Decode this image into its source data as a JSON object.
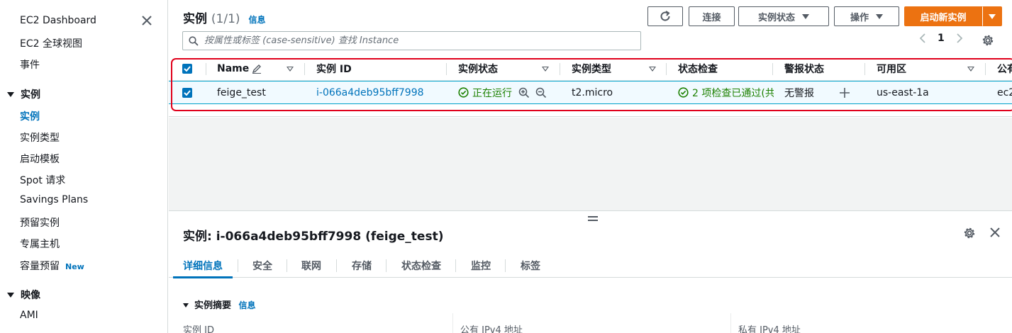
{
  "sidebar": {
    "dashboard": "EC2 Dashboard",
    "global_view": "EC2 全球视图",
    "events": "事件",
    "instances_section": "实例",
    "items": [
      "实例",
      "实例类型",
      "启动模板",
      "Spot 请求",
      "Savings Plans",
      "预留实例",
      "专属主机",
      "容量预留"
    ],
    "new_badge": "New",
    "images_section": "映像",
    "ami": "AMI"
  },
  "header": {
    "title": "实例",
    "count": "(1/1)",
    "info": "信息"
  },
  "toolbar": {
    "connect": "连接",
    "instance_state": "实例状态",
    "actions": "操作",
    "launch": "启动新实例"
  },
  "search": {
    "placeholder": "按属性或标签 (case-sensitive) 查找 Instance"
  },
  "pagination": {
    "current_page": "1"
  },
  "table": {
    "columns": [
      "Name",
      "实例 ID",
      "实例状态",
      "实例类型",
      "状态检查",
      "警报状态",
      "可用区",
      "公有"
    ],
    "rows": [
      {
        "name": "feige_test",
        "instance_id": "i-066a4deb95bff7998",
        "state": "正在运行",
        "type": "t2.micro",
        "status_check": "2 项检查已通过(共",
        "alarm": "无警报",
        "az": "us-east-1a",
        "public": "ec2"
      }
    ]
  },
  "detail": {
    "title": "实例: i-066a4deb95bff7998 (feige_test)",
    "tabs": [
      "详细信息",
      "安全",
      "联网",
      "存储",
      "状态检查",
      "监控",
      "标签"
    ],
    "summary_title": "实例摘要",
    "summary_info": "信息",
    "fields": [
      "实例 ID",
      "公有 IPv4 地址",
      "私有 IPv4 地址"
    ]
  },
  "colors": {
    "accent": "#0073bb",
    "launch_button": "#ec7211",
    "success": "#1d8102",
    "highlight_frame": "#e0001b"
  }
}
